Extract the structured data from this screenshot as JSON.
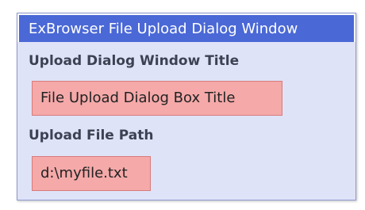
{
  "window": {
    "title": "ExBrowser File Upload Dialog Window"
  },
  "fields": {
    "dialog_title_label": "Upload Dialog Window Title",
    "dialog_title_value": "File Upload Dialog Box Title",
    "file_path_label": "Upload File Path",
    "file_path_value": "d:\\myfile.txt"
  },
  "colors": {
    "titlebar": "#4a68d6",
    "panel": "#dfe3f8",
    "field_fill": "#f5a9a9",
    "field_border": "#d77b7b",
    "label_text": "#3c4252"
  }
}
